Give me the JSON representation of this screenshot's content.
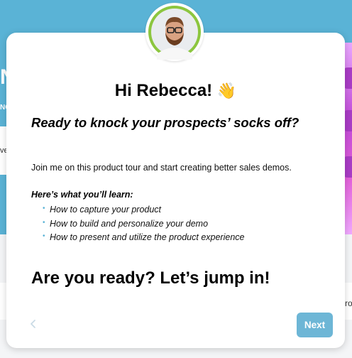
{
  "modal": {
    "greeting": "Hi Rebecca!",
    "greeting_emoji": "👋",
    "subtitle": "Ready to knock your prospects’ socks off?",
    "intro": "Join me on this product tour and start creating better sales demos.",
    "learn_title": "Here’s what you’ll learn:",
    "learn_items": [
      "How to capture your product",
      "How to build and personalize your demo",
      "How to present and utilize the product experience"
    ],
    "cta": "Are you ready? Let’s jump in!",
    "prev_icon": "chevron-left-icon",
    "next_label": "Next"
  },
  "background": {
    "fragment_1": "N",
    "fragment_2": "NO",
    "fragment_3": "ve",
    "fragment_4": "ro"
  },
  "colors": {
    "header_blue": "#5ab3d6",
    "next_button": "#6db6d6",
    "avatar_ring": "#8cc63f"
  }
}
